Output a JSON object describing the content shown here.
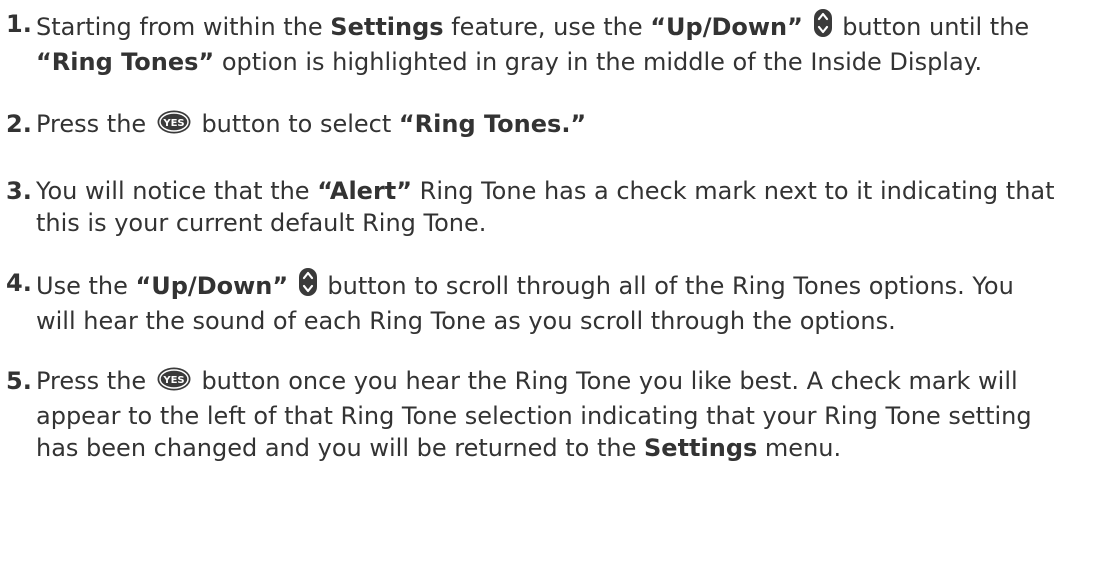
{
  "steps": [
    {
      "number": "1.",
      "parts": [
        "Starting from within the ",
        "Settings",
        " feature, use the ",
        "“Up/Down”",
        " button until the ",
        "“Ring Tones”",
        " option is highlighted in gray in the middle of the Inside Display."
      ]
    },
    {
      "number": "2.",
      "parts": [
        "Press the ",
        " button to select ",
        "“Ring Tones.”"
      ]
    },
    {
      "number": "3.",
      "parts": [
        "You will notice that the ",
        "“Alert”",
        " Ring Tone has a check mark next to it indicating that this is your current default Ring Tone."
      ]
    },
    {
      "number": "4.",
      "parts": [
        "Use the ",
        "“Up/Down”",
        " button to scroll through all of the Ring Tones options. You will hear the sound of each Ring Tone as you scroll through the options."
      ]
    },
    {
      "number": "5.",
      "parts": [
        "Press the ",
        " button once you hear the Ring Tone you like best.  A check mark will appear to the left of that Ring Tone selection indicating that your Ring Tone setting has been changed and you will be returned to the ",
        "Settings",
        " menu."
      ]
    }
  ],
  "icons": {
    "yes_button_text": "YES"
  }
}
